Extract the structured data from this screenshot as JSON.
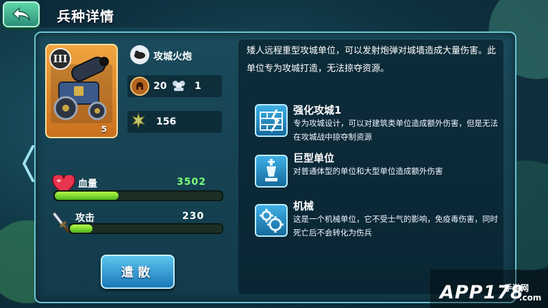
{
  "header": {
    "title": "兵种详情"
  },
  "unit": {
    "rank": "III",
    "level": "5",
    "name": "攻城火炮",
    "cost": "20",
    "population": "1",
    "power": "156"
  },
  "stats": {
    "hp_label": "血量",
    "hp_value": "3502",
    "hp_fill": 0.38,
    "attack_label": "攻击",
    "attack_value": "230",
    "attack_fill": 0.15
  },
  "actions": {
    "dismiss_label": "遣散"
  },
  "description": "矮人远程重型攻城单位，可以发射炮弹对城墙造成大量伤害。此单位专为攻城打造，无法掠夺资源。",
  "abilities": [
    {
      "name": "强化攻城1",
      "desc": "专为攻城设计，可以对建筑类单位造成额外伤害，但是无法在攻城战中掠夺制资源",
      "icon": "wall-break-icon"
    },
    {
      "name": "巨型单位",
      "desc": "对普通体型的单位和大型单位造成额外伤害",
      "icon": "chess-king-icon"
    },
    {
      "name": "机械",
      "desc": "这是一个机械单位，它不受士气的影响，免疫毒伤害，同时死亡后不会转化为伤兵",
      "icon": "gears-icon"
    }
  ],
  "watermark": {
    "main": "APP178",
    "sub": "手游网",
    "com": ".com"
  },
  "colors": {
    "accent": "#6cc6d6",
    "hp_value": "#7bff7b",
    "button": "#1b78b8"
  }
}
